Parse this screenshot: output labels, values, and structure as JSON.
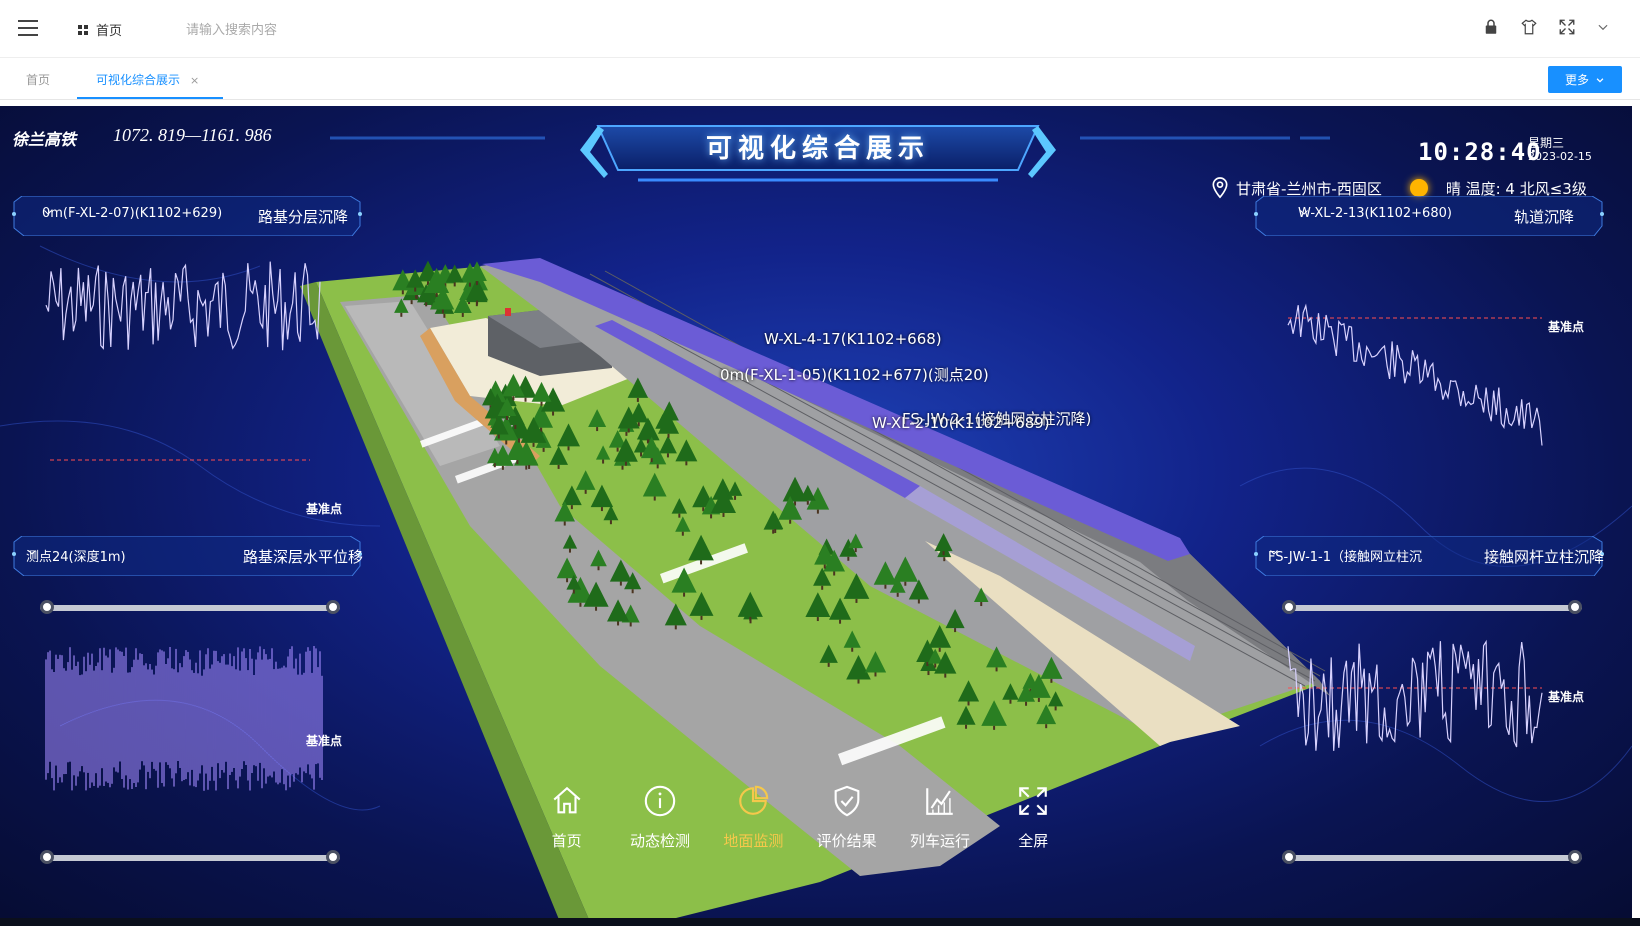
{
  "topbar": {
    "breadcrumb": "首页",
    "search_placeholder": "请输入搜索内容",
    "icons": [
      "lock-icon",
      "shirt-icon",
      "fullscreen-icon",
      "chevron-down-icon"
    ]
  },
  "tabs": [
    {
      "label": "首页",
      "active": false
    },
    {
      "label": "可视化综合展示",
      "active": true
    }
  ],
  "tab_close": "×",
  "more_button": "更多",
  "dashboard": {
    "brand": "徐兰高铁",
    "mileage": "1072. 819—1161. 986",
    "title": "可视化综合展示",
    "time": "10:28:40",
    "weekday": "星期三",
    "date": "2023-02-15",
    "location": "甘肃省-兰州市-西固区",
    "weather": "晴 温度: 4 北风≤3级",
    "colors": {
      "accent": "#1890ff",
      "nav_active": "#f5c84b",
      "reference_line": "#ff4d4f",
      "line_series": "#cfc7ff"
    }
  },
  "panels": {
    "top_left": {
      "sensor": "0m(F-XL-2-07)(K1102+629)",
      "title": "路基分层沉降",
      "reference_label": "基准点"
    },
    "bottom_left": {
      "sensor": "测点24(深度1m)",
      "title": "路基深层水平位移",
      "reference_label": "基准点"
    },
    "top_right": {
      "sensor": "W-XL-2-13(K1102+680)",
      "title": "轨道沉降",
      "reference_label": "基准点"
    },
    "bottom_right": {
      "sensor": "FS-JW-1-1（接触网立柱沉",
      "title": "接触网杆立柱沉降",
      "reference_label": "基准点"
    }
  },
  "scene_labels": [
    "W-XL-4-17(K1102+668)",
    "0m(F-XL-1-05)(K1102+677)(测点20)",
    "FS-JW-2-1(接触网立柱沉降)",
    "W-XL-2-10(K1102+689)"
  ],
  "nav": [
    {
      "label": "首页",
      "icon": "home-icon",
      "active": false
    },
    {
      "label": "动态检测",
      "icon": "info-icon",
      "active": false
    },
    {
      "label": "地面监测",
      "icon": "pie-chart-icon",
      "active": true
    },
    {
      "label": "评价结果",
      "icon": "shield-check-icon",
      "active": false
    },
    {
      "label": "列车运行",
      "icon": "line-chart-icon",
      "active": false
    },
    {
      "label": "全屏",
      "icon": "fullscreen-icon",
      "active": false
    }
  ]
}
